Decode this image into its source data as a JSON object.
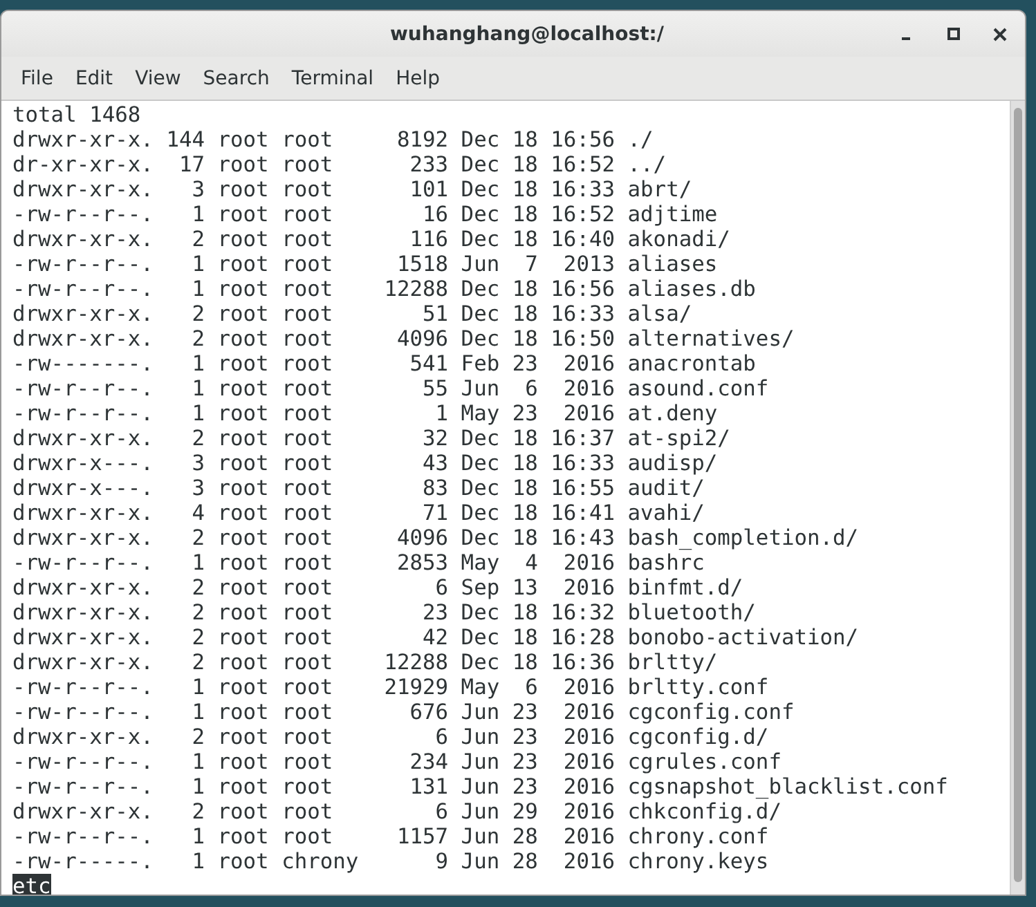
{
  "window": {
    "title": "wuhanghang@localhost:/"
  },
  "menu": [
    "File",
    "Edit",
    "View",
    "Search",
    "Terminal",
    "Help"
  ],
  "terminal": {
    "lines": [
      "total 1468",
      "drwxr-xr-x. 144 root root     8192 Dec 18 16:56 ./",
      "dr-xr-xr-x.  17 root root      233 Dec 18 16:52 ../",
      "drwxr-xr-x.   3 root root      101 Dec 18 16:33 abrt/",
      "-rw-r--r--.   1 root root       16 Dec 18 16:52 adjtime",
      "drwxr-xr-x.   2 root root      116 Dec 18 16:40 akonadi/",
      "-rw-r--r--.   1 root root     1518 Jun  7  2013 aliases",
      "-rw-r--r--.   1 root root    12288 Dec 18 16:56 aliases.db",
      "drwxr-xr-x.   2 root root       51 Dec 18 16:33 alsa/",
      "drwxr-xr-x.   2 root root     4096 Dec 18 16:50 alternatives/",
      "-rw-------.   1 root root      541 Feb 23  2016 anacrontab",
      "-rw-r--r--.   1 root root       55 Jun  6  2016 asound.conf",
      "-rw-r--r--.   1 root root        1 May 23  2016 at.deny",
      "drwxr-xr-x.   2 root root       32 Dec 18 16:37 at-spi2/",
      "drwxr-x---.   3 root root       43 Dec 18 16:33 audisp/",
      "drwxr-x---.   3 root root       83 Dec 18 16:55 audit/",
      "drwxr-xr-x.   4 root root       71 Dec 18 16:41 avahi/",
      "drwxr-xr-x.   2 root root     4096 Dec 18 16:43 bash_completion.d/",
      "-rw-r--r--.   1 root root     2853 May  4  2016 bashrc",
      "drwxr-xr-x.   2 root root        6 Sep 13  2016 binfmt.d/",
      "drwxr-xr-x.   2 root root       23 Dec 18 16:32 bluetooth/",
      "drwxr-xr-x.   2 root root       42 Dec 18 16:28 bonobo-activation/",
      "drwxr-xr-x.   2 root root    12288 Dec 18 16:36 brltty/",
      "-rw-r--r--.   1 root root    21929 May  6  2016 brltty.conf",
      "-rw-r--r--.   1 root root      676 Jun 23  2016 cgconfig.conf",
      "drwxr-xr-x.   2 root root        6 Jun 23  2016 cgconfig.d/",
      "-rw-r--r--.   1 root root      234 Jun 23  2016 cgrules.conf",
      "-rw-r--r--.   1 root root      131 Jun 23  2016 cgsnapshot_blacklist.conf",
      "drwxr-xr-x.   2 root root        6 Jun 29  2016 chkconfig.d/",
      "-rw-r--r--.   1 root root     1157 Jun 28  2016 chrony.conf",
      "-rw-r-----.   1 root chrony      9 Jun 28  2016 chrony.keys"
    ],
    "status_line": {
      "text": "etc",
      "highlighted": true
    }
  }
}
